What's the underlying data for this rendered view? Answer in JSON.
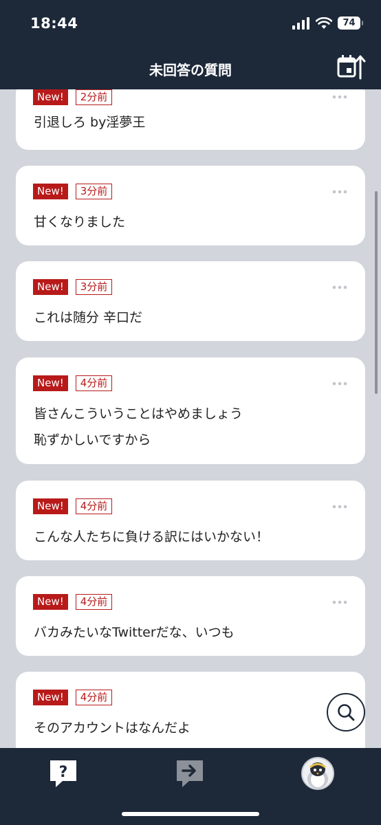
{
  "status_bar": {
    "time": "18:44",
    "battery": "74"
  },
  "nav": {
    "title": "未回答の質問"
  },
  "questions": [
    {
      "badge": "New!",
      "time": "2分前",
      "lines": [
        "引退しろ by淫夢王"
      ]
    },
    {
      "badge": "New!",
      "time": "3分前",
      "lines": [
        "甘くなりました"
      ]
    },
    {
      "badge": "New!",
      "time": "3分前",
      "lines": [
        "これは随分 辛口だ"
      ]
    },
    {
      "badge": "New!",
      "time": "4分前",
      "lines": [
        "皆さんこういうことはやめましょう",
        "恥ずかしいですから"
      ]
    },
    {
      "badge": "New!",
      "time": "4分前",
      "lines": [
        "こんな人たちに負ける訳にはいかない！"
      ]
    },
    {
      "badge": "New!",
      "time": "4分前",
      "lines": [
        "バカみたいなTwitterだな、いつも"
      ]
    },
    {
      "badge": "New!",
      "time": "4分前",
      "lines": [
        "そのアカウントはなんだよ"
      ]
    }
  ],
  "colors": {
    "navy": "#1d2839",
    "accent_red": "#b81a1a",
    "list_bg": "#d2d5db"
  },
  "tab_bar": {
    "icons": [
      "question-bubble-icon",
      "send-arrow-icon",
      "avatar"
    ]
  }
}
